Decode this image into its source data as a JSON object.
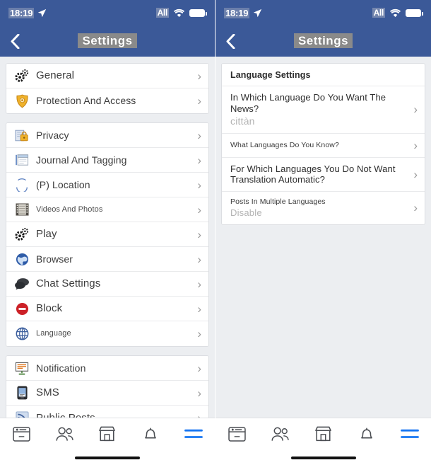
{
  "status_bar": {
    "time": "18:19",
    "location_icon": "location-arrow-icon",
    "carrier_label": "All",
    "wifi_icon": "wifi-icon",
    "battery_icon": "battery-icon"
  },
  "nav": {
    "back_icon": "chevron-left-icon",
    "title": "Settings"
  },
  "left_panel": {
    "groups": [
      {
        "rows": [
          {
            "icon": "gears-icon",
            "label": "General",
            "size": "lg"
          },
          {
            "icon": "shield-badge-icon",
            "label": "Protection And Access",
            "size": "md"
          }
        ]
      },
      {
        "rows": [
          {
            "icon": "lock-document-icon",
            "label": "Privacy",
            "size": "md"
          },
          {
            "icon": "journal-icon",
            "label": "Journal And Tagging",
            "size": "md"
          },
          {
            "icon": "location-pin-icon",
            "label": "(P) Location",
            "size": "md"
          },
          {
            "icon": "film-strip-icon",
            "label": "Videos And Photos",
            "size": "sm"
          },
          {
            "icon": "gears-icon",
            "label": "Play",
            "size": "lg"
          },
          {
            "icon": "globe-blue-icon",
            "label": "Browser",
            "size": "md"
          },
          {
            "icon": "chat-bubbles-icon",
            "label": "Chat Settings",
            "size": "lg"
          },
          {
            "icon": "block-icon",
            "label": "Block",
            "size": "lg"
          },
          {
            "icon": "globe-grid-icon",
            "label": "Language",
            "size": "sm"
          }
        ]
      },
      {
        "rows": [
          {
            "icon": "notification-board-icon",
            "label": "Notification",
            "size": "md"
          },
          {
            "icon": "phone-sms-icon",
            "label": "SMS",
            "size": "lg"
          },
          {
            "icon": "rss-icon",
            "label": "Public Posts",
            "size": "lg"
          }
        ]
      }
    ],
    "chevron": "›"
  },
  "right_panel": {
    "section_header": "Language Settings",
    "rows": [
      {
        "title": "In Which Language Do You Want The News?",
        "subtitle": "cittàn",
        "size": "md"
      },
      {
        "title": "What Languages Do You Know?",
        "subtitle": "",
        "size": "sm"
      },
      {
        "title": "For Which Languages You Do Not Want Translation Automatic?",
        "subtitle": "",
        "size": "md"
      },
      {
        "title": "Posts In Multiple Languages",
        "subtitle": "Disable",
        "size": "sm"
      }
    ],
    "chevron": "›"
  },
  "tab_bar": {
    "tabs": [
      {
        "icon": "news-feed-icon",
        "label": "News Feed",
        "active": false
      },
      {
        "icon": "friends-icon",
        "label": "Friends",
        "active": false
      },
      {
        "icon": "marketplace-icon",
        "label": "Marketplace",
        "active": false
      },
      {
        "icon": "notifications-bell-icon",
        "label": "Notifications",
        "active": false
      },
      {
        "icon": "menu-hamburger-icon",
        "label": "Menu",
        "active": true
      }
    ],
    "home_indicator": "home-indicator"
  },
  "colors": {
    "brand_blue": "#3b5998",
    "accent_blue": "#1877f2",
    "background_gray": "#eceef1",
    "row_white": "#ffffff",
    "text_dark": "#3c3c3c",
    "text_muted": "#b3b3b3",
    "chevron_gray": "#9a9a9a",
    "block_red": "#cc2127",
    "shield_gold": "#f2b41e"
  }
}
